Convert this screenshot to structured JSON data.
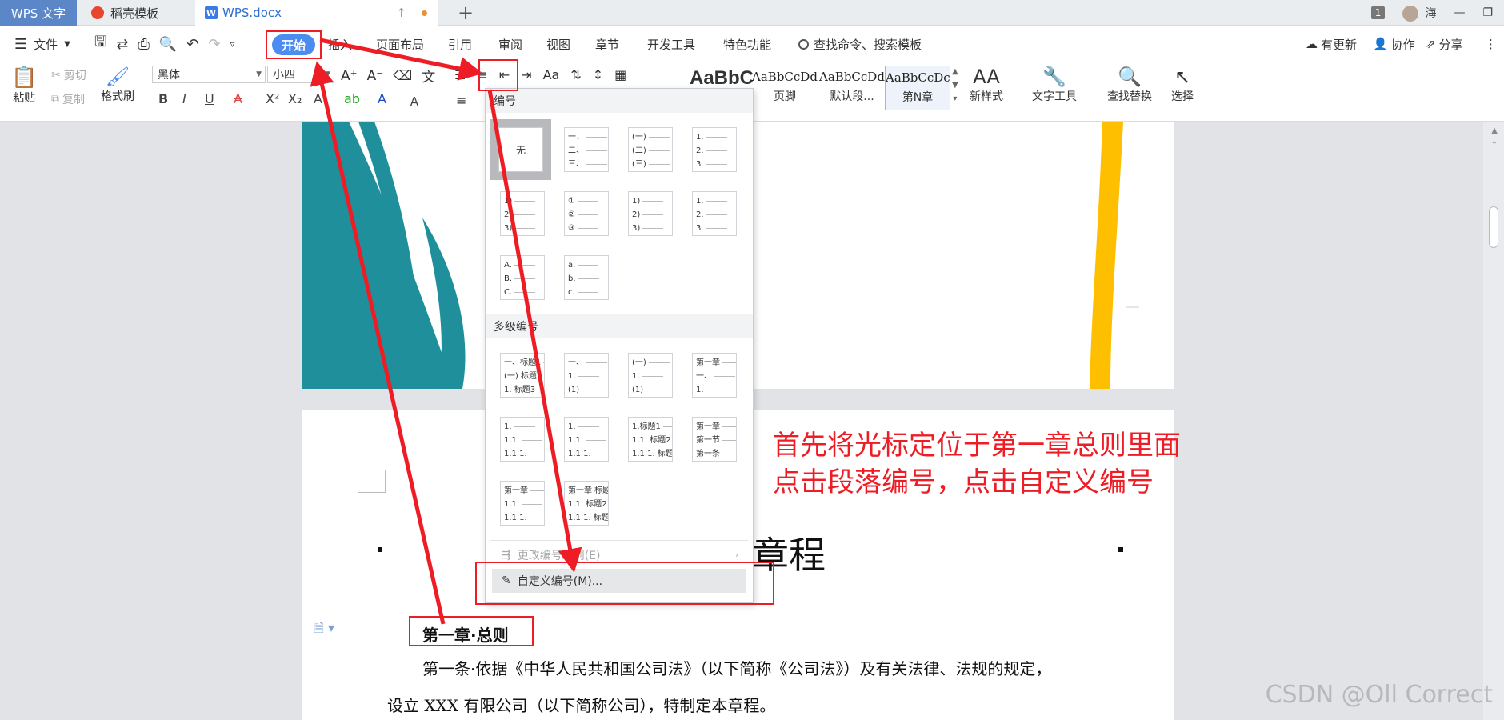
{
  "tabs": {
    "app": "WPS 文字",
    "template": "稻壳模板",
    "doc": "WPS.docx",
    "doc_icon": "W"
  },
  "window": {
    "badge": "1",
    "user": "海"
  },
  "menu": {
    "file": "文件",
    "start": "开始",
    "insert": "插入",
    "layout": "页面布局",
    "reference": "引用",
    "review": "审阅",
    "view": "视图",
    "chapter": "章节",
    "devtools": "开发工具",
    "special": "特色功能",
    "search": "查找命令、搜索模板",
    "update": "有更新",
    "collab": "协作",
    "share": "分享"
  },
  "ribbon": {
    "paste": "粘贴",
    "cut": "剪切",
    "copy": "复制",
    "format_painter": "格式刷",
    "font": "黑体",
    "size": "小四",
    "style_big": "AaBbC",
    "styles": [
      {
        "sample": "AaBbCcDd",
        "name": "页脚"
      },
      {
        "sample": "AaBbCcDd",
        "name": "默认段..."
      },
      {
        "sample": "AaBbCcDc",
        "name": "第N章"
      }
    ],
    "new_style": "新样式",
    "text_tools": "文字工具",
    "find_replace": "查找替换",
    "select": "选择"
  },
  "dropdown": {
    "numbering": "编号",
    "none": "无",
    "single": [
      [
        "一、",
        "二、",
        "三、"
      ],
      [
        "(一)",
        "(二)",
        "(三)"
      ],
      [
        "1.",
        "2.",
        "3."
      ],
      [
        "1)",
        "2)",
        "3)"
      ],
      [
        "①",
        "②",
        "③"
      ],
      [
        "1)",
        "2)",
        "3)"
      ],
      [
        "1.",
        "2.",
        "3."
      ],
      [
        "A.",
        "B.",
        "C."
      ],
      [
        "a.",
        "b.",
        "c."
      ]
    ],
    "multilevel": "多级编号",
    "multi": [
      [
        "一、标题1",
        "(一) 标题2",
        "1. 标题3"
      ],
      [
        "一、",
        "1.",
        "(1)"
      ],
      [
        "(一)",
        "1.",
        "(1)"
      ],
      [
        "第一章",
        "一、",
        "1."
      ],
      [
        "1.",
        "1.1.",
        "1.1.1."
      ],
      [
        "1.",
        "1.1.",
        "1.1.1."
      ],
      [
        "1.标题1",
        "1.1. 标题2",
        "1.1.1. 标题3"
      ],
      [
        "第一章",
        "第一节",
        "第一条"
      ],
      [
        "第一章",
        "1.1.",
        "1.1.1."
      ],
      [
        "第一章 标题1",
        "1.1. 标题2",
        "1.1.1. 标题3"
      ]
    ],
    "change_level": "更改编号级别(E)",
    "custom": "自定义编号(M)..."
  },
  "annotation": {
    "line1": "首先将光标定位于第一章总则里面",
    "line2": "点击段落编号，点击自定义编号"
  },
  "document": {
    "title": "章程",
    "chapter": "第一章·总则",
    "para1": "第一条·依据《中华人民共和国公司法》（以下简称《公司法》）及有关法律、法规的规定，",
    "para2": "设立 XXX 有限公司（以下简称公司），特制定本章程。"
  },
  "watermark": "CSDN @Oll Correct",
  "colors": {
    "accent": "#4b8cf0",
    "annotation": "#ee1c25",
    "teal": "#1e8f9b",
    "gold": "#fdbf00"
  }
}
